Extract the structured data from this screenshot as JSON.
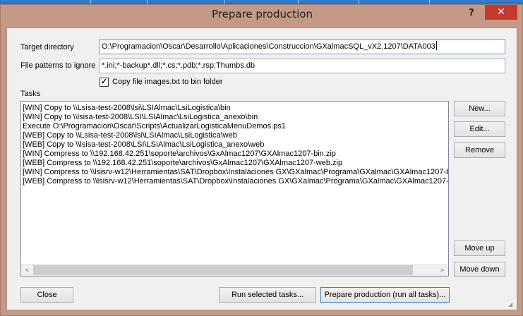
{
  "window": {
    "title": "Prepare production",
    "help": "?",
    "close": "✕"
  },
  "form": {
    "target_label": "Target directory",
    "target_value": "O:\\Programacion\\Oscar\\Desarrollo\\Aplicaciones\\Construccion\\GXalmacSQL_vX2.1207\\DATA003",
    "ignore_label": "File patterns to ignore",
    "ignore_value": "*.ini;*-backup*.dll;*.cs;*.pdb;*.rsp;Thumbs.db",
    "copy_images_label": "Copy file images.txt to bin folder",
    "copy_images_checked": true,
    "tasks_label": "Tasks"
  },
  "tasks": [
    "[WIN]  Copy to \\\\Lsisa-test-2008\\lsi\\LSIAlmac\\LsiLogistica\\bin",
    "[WIN]  Copy to \\\\lsisa-test-2008\\LSI\\LSIAlmac\\LsiLogistica_anexo\\bin",
    "Execute O:\\Programacion\\Oscar\\Scripts\\ActualizarLogisticaMenuDemos.ps1",
    "[WEB]  Copy to \\\\Lsisa-test-2008\\lsi\\LSIAlmac\\LsiLogistica\\web",
    "[WEB]  Copy to \\\\lsisa-test-2008\\LSI\\LSIAlmac\\LsiLogistica_anexo\\web",
    "[WIN]  Compress to \\\\192.168.42.251\\soporte\\archivos\\GxAlmac1207\\GXAlmac1207-bin.zip",
    "[WEB]  Compress to \\\\192.168.42.251\\soporte\\archivos\\GxAlmac1207\\GXAlmac1207-web.zip",
    "[WIN]  Compress to \\\\lsisrv-w12\\Herramientas\\SAT\\Dropbox\\Instalaciones GX\\GXalmac\\Programa\\GXalmac\\GXAlmac1207-b",
    "[WEB]  Compress to \\\\lsisrv-w12\\Herramientas\\SAT\\Dropbox\\Instalaciones GX\\GXalmac\\Programa\\GXalmac\\GXAlmac1207-w"
  ],
  "buttons": {
    "new": "New...",
    "edit": "Edit...",
    "remove": "Remove",
    "move_up": "Move up",
    "move_down": "Move down",
    "close": "Close",
    "run_selected": "Run selected tasks...",
    "prepare_all": "Prepare production (run all tasks)..."
  },
  "scrollbar": {
    "left_arrow": "<",
    "right_arrow": ">"
  }
}
